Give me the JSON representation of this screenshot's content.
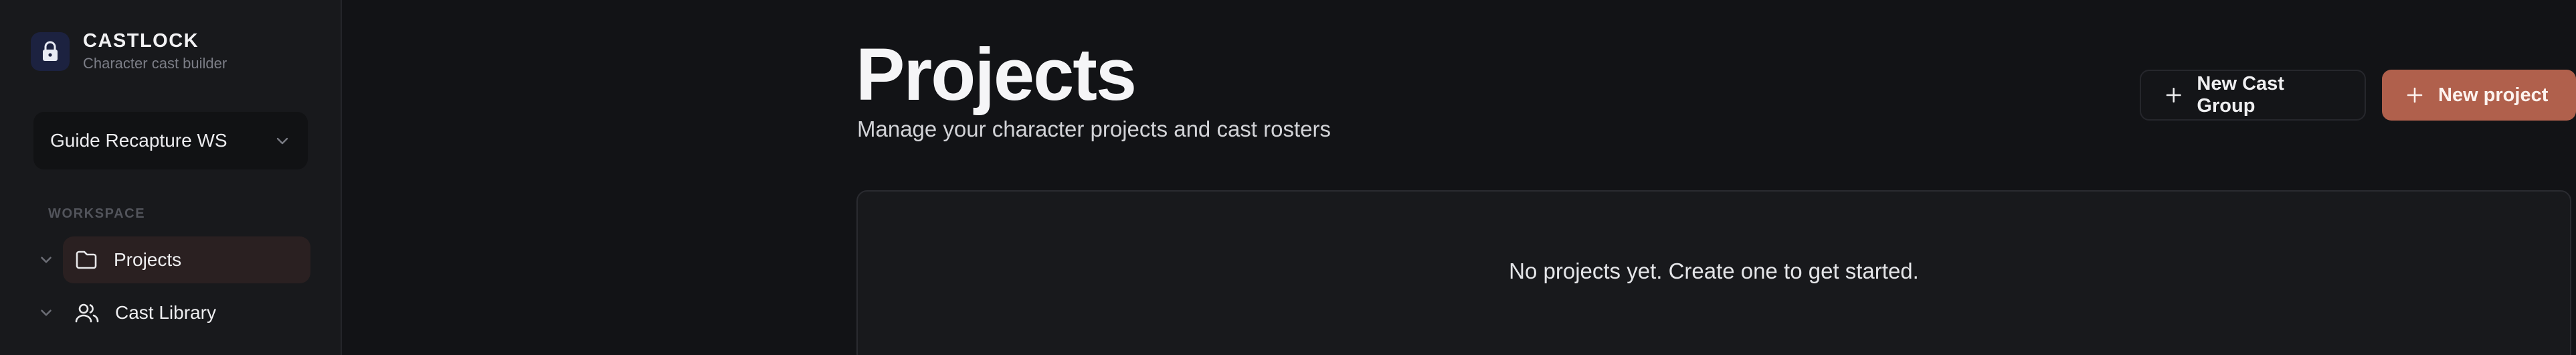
{
  "brand": {
    "name": "CASTLOCK",
    "subtitle": "Character cast builder",
    "logo_icon": "lock-icon"
  },
  "workspace": {
    "selected": "Guide Recapture WS"
  },
  "sidebar": {
    "section_label": "WORKSPACE",
    "items": [
      {
        "label": "Projects",
        "icon": "folder-icon",
        "active": true
      },
      {
        "label": "Cast Library",
        "icon": "users-icon",
        "active": false
      }
    ]
  },
  "page": {
    "title": "Projects",
    "subtitle": "Manage your character projects and cast rosters"
  },
  "actions": {
    "new_cast_group": "New Cast Group",
    "new_project": "New project"
  },
  "empty_state": {
    "message": "No projects yet. Create one to get started."
  },
  "colors": {
    "accent": "#b0604c",
    "background": "#121316",
    "sidebar": "#18191c"
  }
}
